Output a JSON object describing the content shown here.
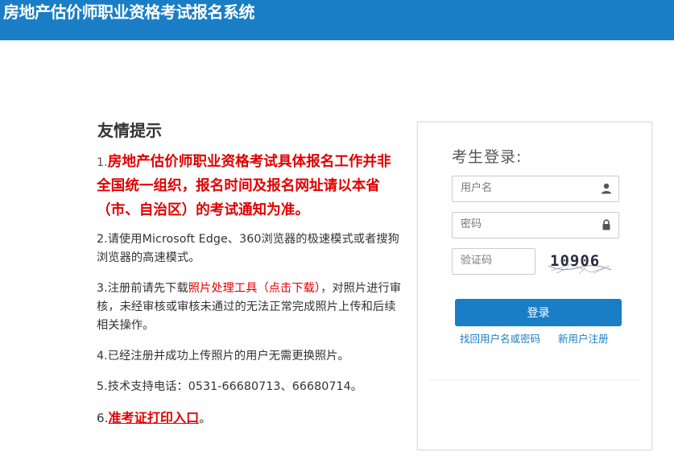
{
  "header": {
    "title": "房地产估价师职业资格考试报名系统"
  },
  "notice": {
    "title": "友情提示",
    "item1": {
      "num": "1.",
      "text": "房地产估价师职业资格考试具体报名工作并非全国统一组织，报名时间及报名网址请以本省（市、自治区）的考试通知为准。"
    },
    "item2": "2.请使用Microsoft Edge、360浏览器的极速模式或者搜狗浏览器的高速模式。",
    "item3": {
      "prefix": "3.注册前请先下载",
      "link": "照片处理工具（点击下载）",
      "suffix": "，对照片进行审核，未经审核或审核未通过的无法正常完成照片上传和后续相关操作。"
    },
    "item4": "4.已经注册并成功上传照片的用户无需更换照片。",
    "item5": "5.技术支持电话：0531-66680713、66680714。",
    "item6": {
      "num": "6.",
      "link": "准考证打印入口",
      "suffix": "。"
    }
  },
  "login": {
    "title": "考生登录:",
    "username_placeholder": "用户名",
    "password_placeholder": "密码",
    "captcha_placeholder": "验证码",
    "captcha_text": "10906",
    "login_label": "登录",
    "forgot_label": "找回用户名或密码",
    "register_label": "新用户注册"
  },
  "colors": {
    "brand": "#1a7ec6",
    "alert": "#e00000"
  },
  "icons": {
    "username": "user-icon",
    "password": "lock-icon"
  }
}
